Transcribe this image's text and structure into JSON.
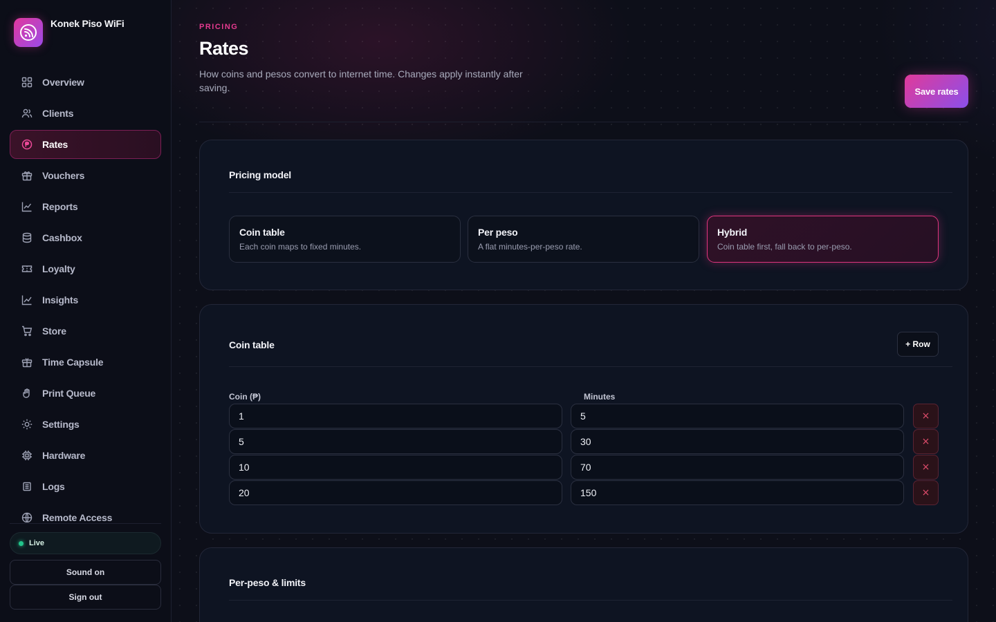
{
  "brand": {
    "name": "Konek Piso WiFi"
  },
  "sidebar": {
    "items": [
      {
        "label": "Overview",
        "icon": "grid-icon"
      },
      {
        "label": "Clients",
        "icon": "users-icon"
      },
      {
        "label": "Rates",
        "icon": "peso-icon",
        "active": true
      },
      {
        "label": "Vouchers",
        "icon": "gift-icon"
      },
      {
        "label": "Reports",
        "icon": "chart-line-icon"
      },
      {
        "label": "Cashbox",
        "icon": "database-icon"
      },
      {
        "label": "Loyalty",
        "icon": "ticket-icon"
      },
      {
        "label": "Insights",
        "icon": "trend-icon"
      },
      {
        "label": "Store",
        "icon": "cart-icon"
      },
      {
        "label": "Time Capsule",
        "icon": "gift-box-icon"
      },
      {
        "label": "Print Queue",
        "icon": "hand-icon"
      },
      {
        "label": "Settings",
        "icon": "sun-gear-icon"
      },
      {
        "label": "Hardware",
        "icon": "chip-icon"
      },
      {
        "label": "Logs",
        "icon": "list-icon"
      },
      {
        "label": "Remote Access",
        "icon": "globe-icon"
      }
    ],
    "status": "Live",
    "sound_label": "Sound on",
    "signout_label": "Sign out"
  },
  "header": {
    "eyebrow": "PRICING",
    "title": "Rates",
    "subtitle": "How coins and pesos convert to internet time. Changes apply instantly after saving.",
    "save_label": "Save rates"
  },
  "pricing_model": {
    "title": "Pricing model",
    "options": [
      {
        "title": "Coin table",
        "desc": "Each coin maps to fixed minutes."
      },
      {
        "title": "Per peso",
        "desc": "A flat minutes-per-peso rate."
      },
      {
        "title": "Hybrid",
        "desc": "Coin table first, fall back to per-peso.",
        "selected": true
      }
    ]
  },
  "coin_table": {
    "title": "Coin table",
    "add_label": "+ Row",
    "col_coin": "Coin (₱)",
    "col_minutes": "Minutes",
    "rows": [
      {
        "coin": "1",
        "minutes": "5"
      },
      {
        "coin": "5",
        "minutes": "30"
      },
      {
        "coin": "10",
        "minutes": "70"
      },
      {
        "coin": "20",
        "minutes": "150"
      }
    ],
    "delete_glyph": "×"
  },
  "per_peso": {
    "title": "Per-peso & limits"
  },
  "colors": {
    "accent": "#e53a8f",
    "accent2": "#8b4fea",
    "live": "#22c58b",
    "bg": "#0d0f19"
  }
}
